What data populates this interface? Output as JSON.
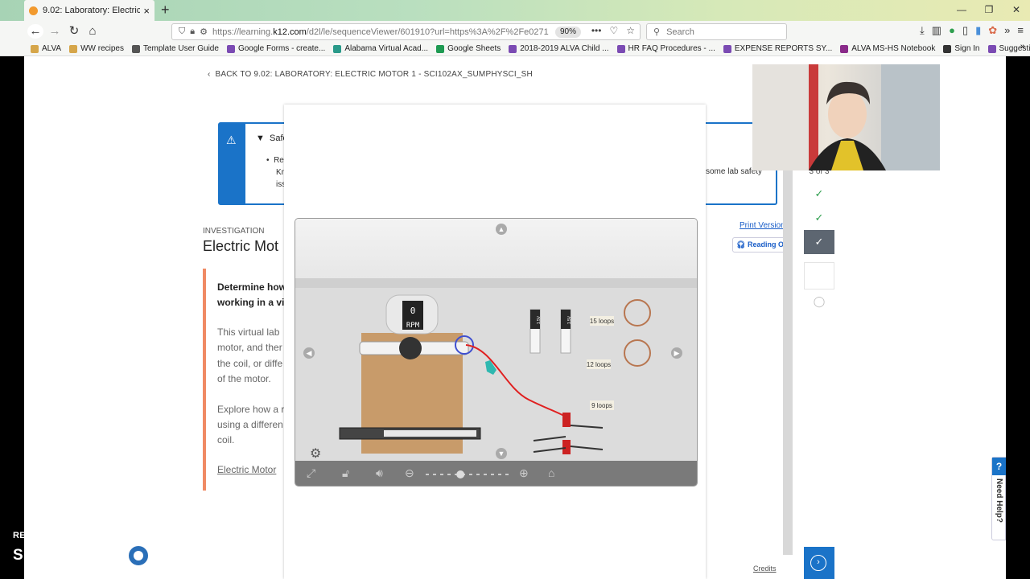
{
  "browser": {
    "tab_title": "9.02: Laboratory: Electric Moto",
    "url_prefix": "https://learning.",
    "url_domain": "k12.com",
    "url_rest": "/d2l/le/sequenceViewer/601910?url=https%3A%2F%2Fe0271",
    "zoom": "90%",
    "search_placeholder": "Search"
  },
  "bookmarks": [
    {
      "label": "ALVA",
      "color": "#d6a64a"
    },
    {
      "label": "WW recipes",
      "color": "#d6a64a"
    },
    {
      "label": "Template User Guide",
      "color": "#555555"
    },
    {
      "label": "Google Forms - create...",
      "color": "#7b4bb3"
    },
    {
      "label": "Alabama Virtual Acad...",
      "color": "#2a9a8a"
    },
    {
      "label": "Google Sheets",
      "color": "#1e9a52"
    },
    {
      "label": "2018-2019 ALVA Child ...",
      "color": "#7b4bb3"
    },
    {
      "label": "HR FAQ Procedures - ...",
      "color": "#7b4bb3"
    },
    {
      "label": "EXPENSE REPORTS SY...",
      "color": "#7b4bb3"
    },
    {
      "label": "ALVA MS-HS Notebook",
      "color": "#8a2b8a"
    },
    {
      "label": "Sign In",
      "color": "#333333"
    },
    {
      "label": "Suggestion Box",
      "color": "#7b4bb3"
    }
  ],
  "page": {
    "back_link": "BACK TO 9.02: LABORATORY: ELECTRIC MOTOR 1 - SCI102AX_SUMPHYSCI_SH",
    "safety_title": "Safe",
    "safety_lines": [
      "Rev",
      "Kno",
      "iss"
    ],
    "safety_right": "some lab safety",
    "investigation_label": "INVESTIGATION",
    "heading": "Electric Mot",
    "card_bold": [
      "Determine how",
      "working in a vi"
    ],
    "card_p1": [
      "This virtual lab",
      "motor, and ther",
      "the coil, or diffe",
      "of the motor."
    ],
    "card_p2": [
      "Explore how a r",
      "using a differen",
      "coil."
    ],
    "card_link": "Electric Motor",
    "print_version": "Print Version",
    "reading": "Reading Op",
    "progress_count": "3 of 3",
    "credits": "Credits",
    "need_help": "Need Help?"
  },
  "sim": {
    "rpm_value": "0",
    "rpm_unit": "RPM",
    "coil_labels": [
      "15 loops",
      "12 loops",
      "9 loops"
    ],
    "battery_label": "1.5V",
    "zoom_level": 0.4
  },
  "watermark": {
    "line1": "RECORDED WITH",
    "line2a": "SCREENCAST",
    "line2b": "MATIC"
  }
}
